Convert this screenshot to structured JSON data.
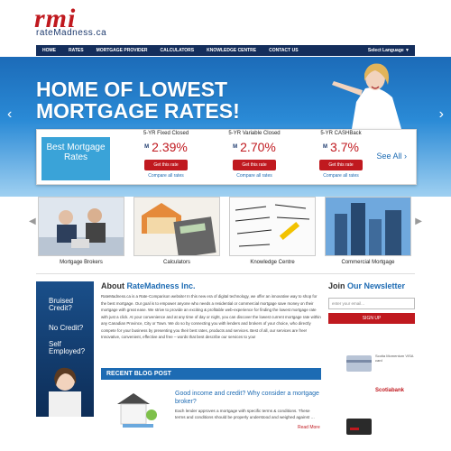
{
  "brand": {
    "logo_text": "rmi",
    "domain_text": "rateMadness.ca"
  },
  "nav": {
    "items": [
      "HOME",
      "RATES",
      "MORTGAGE PROVIDER",
      "CALCULATORS",
      "KNOWLEDGE CENTRE",
      "CONTACT US"
    ],
    "language": "Select Language ▼"
  },
  "hero": {
    "headline": "HOME OF LOWEST MORTGAGE RATES!",
    "prev": "‹",
    "next": "›"
  },
  "rates": {
    "best_label": "Best Mortgage Rates",
    "columns": [
      {
        "title": "5-YR Fixed Closed",
        "value": "2.39%",
        "button": "Get this rate",
        "compare": "Compare all rates"
      },
      {
        "title": "5-YR Variable Closed",
        "value": "2.70%",
        "button": "Get this rate",
        "compare": "Compare all rates"
      },
      {
        "title": "5-YR CASHBack",
        "value": "3.7%",
        "button": "Get this rate",
        "compare": "Compare all rates"
      }
    ],
    "mini_logo": "M",
    "see_all": "See All ›"
  },
  "tiles": [
    "Mortgage Brokers",
    "Calculators",
    "Knowledge Centre",
    "Commercial Mortgage"
  ],
  "banner": {
    "line1": "Bruised Credit?",
    "line2": "No Credit?",
    "line3": "Self Employed?"
  },
  "about": {
    "heading_prefix": "About",
    "heading_brand": "RateMadness Inc.",
    "body": "RateMadness.ca is a Rate-Comparison website! In this new era of digital technology, we offer an innovative way to shop for the best mortgage. Our goal is to empower anyone who needs a residential or commercial mortgage save money on their mortgage with great ease. We strive to provide an exciting & profitable web-experience for finding the lowest mortgage rate with just a click. At your convenience and at any time of day or night, you can discover the lowest current mortgage rate within any Canadian Province, City or Town. We do so by connecting you with lenders and brokers of your choice, who directly compete for your business by presenting you their best rates, products and services. Best of all, our services are free! Innovative, convenient, effective and free – words that best describe our services to you!"
  },
  "blog": {
    "bar_label": "RECENT BLOG POST",
    "title": "Good income and credit? Why consider a mortgage broker?",
    "excerpt": "Each lender approves a mortgage with specific terms & conditions. These terms and conditions should be properly understood and weighed against …",
    "read_more": "Read More"
  },
  "newsletter": {
    "heading_prefix": "Join",
    "heading_rest": "Our Newsletter",
    "placeholder": "enter your email...",
    "button": "SIGN UP"
  },
  "ads": [
    "Scotia Momentum VISA card",
    "Scotiabank"
  ],
  "colors": {
    "brand_red": "#c0191f",
    "navy": "#142e5c",
    "blue": "#1d6bb3"
  }
}
